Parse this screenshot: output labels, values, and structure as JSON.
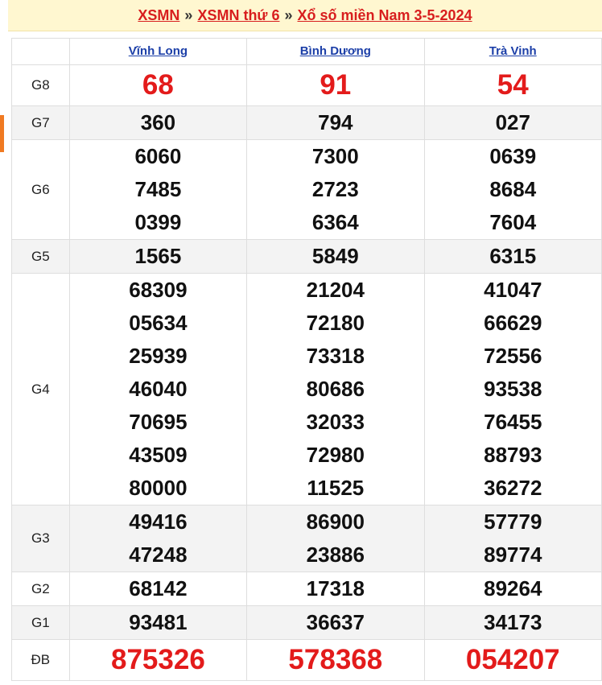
{
  "breadcrumb": {
    "item1": "XSMN",
    "sep": "»",
    "item2": "XSMN thứ 6",
    "item3": "Xổ số miền Nam 3-5-2024"
  },
  "provinces": [
    "Vĩnh Long",
    "Bình Dương",
    "Trà Vinh"
  ],
  "prizes": [
    {
      "label": "G8",
      "alt": false,
      "style": "red-big",
      "values": [
        [
          "68"
        ],
        [
          "91"
        ],
        [
          "54"
        ]
      ]
    },
    {
      "label": "G7",
      "alt": true,
      "style": "",
      "values": [
        [
          "360"
        ],
        [
          "794"
        ],
        [
          "027"
        ]
      ]
    },
    {
      "label": "G6",
      "alt": false,
      "style": "",
      "values": [
        [
          "6060",
          "7485",
          "0399"
        ],
        [
          "7300",
          "2723",
          "6364"
        ],
        [
          "0639",
          "8684",
          "7604"
        ]
      ]
    },
    {
      "label": "G5",
      "alt": true,
      "style": "",
      "values": [
        [
          "1565"
        ],
        [
          "5849"
        ],
        [
          "6315"
        ]
      ]
    },
    {
      "label": "G4",
      "alt": false,
      "style": "",
      "values": [
        [
          "68309",
          "05634",
          "25939",
          "46040",
          "70695",
          "43509",
          "80000"
        ],
        [
          "21204",
          "72180",
          "73318",
          "80686",
          "32033",
          "72980",
          "11525"
        ],
        [
          "41047",
          "66629",
          "72556",
          "93538",
          "76455",
          "88793",
          "36272"
        ]
      ]
    },
    {
      "label": "G3",
      "alt": true,
      "style": "",
      "values": [
        [
          "49416",
          "47248"
        ],
        [
          "86900",
          "23886"
        ],
        [
          "57779",
          "89774"
        ]
      ]
    },
    {
      "label": "G2",
      "alt": false,
      "style": "",
      "values": [
        [
          "68142"
        ],
        [
          "17318"
        ],
        [
          "89264"
        ]
      ]
    },
    {
      "label": "G1",
      "alt": true,
      "style": "",
      "values": [
        [
          "93481"
        ],
        [
          "36637"
        ],
        [
          "34173"
        ]
      ]
    },
    {
      "label": "ĐB",
      "alt": false,
      "style": "red-db",
      "values": [
        [
          "875326"
        ],
        [
          "578368"
        ],
        [
          "054207"
        ]
      ]
    }
  ],
  "colors": {
    "accent_red": "#e31b1b",
    "link_blue": "#1c3fa8",
    "header_bg": "#fff7d0",
    "edge_tab": "#f07a22"
  }
}
